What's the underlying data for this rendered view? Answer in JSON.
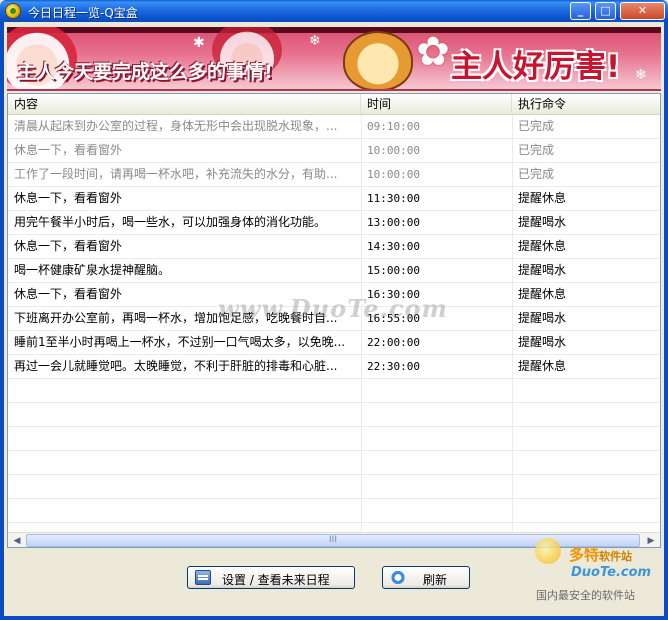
{
  "window": {
    "title": "今日日程一览-Q宝盒",
    "min_glyph": "_",
    "max_glyph": "□",
    "close_glyph": "✕"
  },
  "banner": {
    "left_text": "主人今天要完成这么多的事情!",
    "right_text": "主人好厉害!"
  },
  "table": {
    "headers": [
      "内容",
      "时间",
      "执行命令"
    ],
    "rows": [
      {
        "content": "清晨从起床到办公室的过程，身体无形中会出现脱水现象，...",
        "time": "09:10:00",
        "command": "已完成",
        "status": "done"
      },
      {
        "content": "休息一下，看看窗外",
        "time": "10:00:00",
        "command": "已完成",
        "status": "done"
      },
      {
        "content": "工作了一段时间，请再喝一杯水吧，补充流失的水分，有助...",
        "time": "10:00:00",
        "command": "已完成",
        "status": "done"
      },
      {
        "content": "休息一下，看看窗外",
        "time": "11:30:00",
        "command": "提醒休息",
        "status": "todo"
      },
      {
        "content": "用完午餐半小时后，喝一些水，可以加强身体的消化功能。",
        "time": "13:00:00",
        "command": "提醒喝水",
        "status": "todo"
      },
      {
        "content": "休息一下，看看窗外",
        "time": "14:30:00",
        "command": "提醒休息",
        "status": "todo"
      },
      {
        "content": "喝一杯健康矿泉水提神醒脑。",
        "time": "15:00:00",
        "command": "提醒喝水",
        "status": "todo"
      },
      {
        "content": "休息一下，看看窗外",
        "time": "16:30:00",
        "command": "提醒休息",
        "status": "todo"
      },
      {
        "content": "下班离开办公室前，再喝一杯水，增加饱足感，吃晚餐时自...",
        "time": "16:55:00",
        "command": "提醒喝水",
        "status": "todo"
      },
      {
        "content": "睡前1至半小时再喝上一杯水，不过别一口气喝太多，以免晚...",
        "time": "22:00:00",
        "command": "提醒喝水",
        "status": "todo"
      },
      {
        "content": "再过一会儿就睡觉吧。太晚睡觉，不利于肝脏的排毒和心脏...",
        "time": "22:30:00",
        "command": "提醒休息",
        "status": "todo"
      }
    ],
    "scroll_left": "◀",
    "scroll_right": "▶",
    "scroll_grip": "III"
  },
  "buttons": {
    "settings_label": "设置 / 查看未来日程",
    "refresh_label": "刷新"
  },
  "watermark": {
    "center": "www.DuoTe.com",
    "brand_cn": "多特",
    "brand_cn_suffix": "软件站",
    "brand_url": "DuoTe.com",
    "brand_slogan": "国内最安全的软件站"
  }
}
